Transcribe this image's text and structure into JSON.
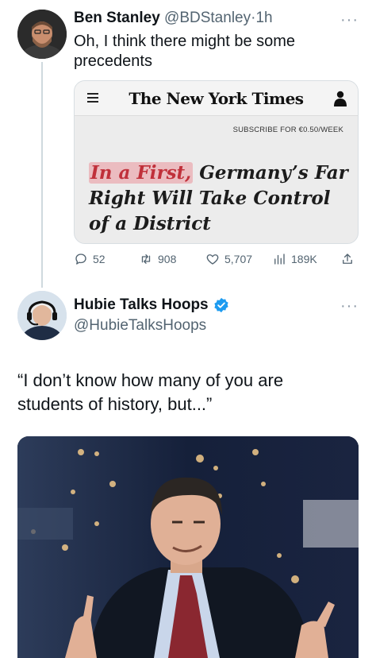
{
  "tweet1": {
    "name": "Ben Stanley",
    "handle": "@BDStanley",
    "separator": "·",
    "time": "1h",
    "more": "···",
    "text": "Oh, I think there might be some precedents",
    "card": {
      "logo": "The New York Times",
      "subscribe": "SUBSCRIBE FOR €0.50/WEEK",
      "headline_highlight": "In a First,",
      "headline_rest": "Germany’s Far Right Will Take Control of a District"
    },
    "actions": {
      "replies": "52",
      "retweets": "908",
      "likes": "5,707",
      "views": "189K"
    }
  },
  "tweet2": {
    "name": "Hubie Talks Hoops",
    "handle": "@HubieTalksHoops",
    "more": "···",
    "text": "“I don’t know how many of you are students of history, but...”"
  },
  "colors": {
    "text": "#0f1419",
    "secondary": "#536471",
    "verified": "#1d9bf0",
    "highlight": "#c0303a"
  }
}
